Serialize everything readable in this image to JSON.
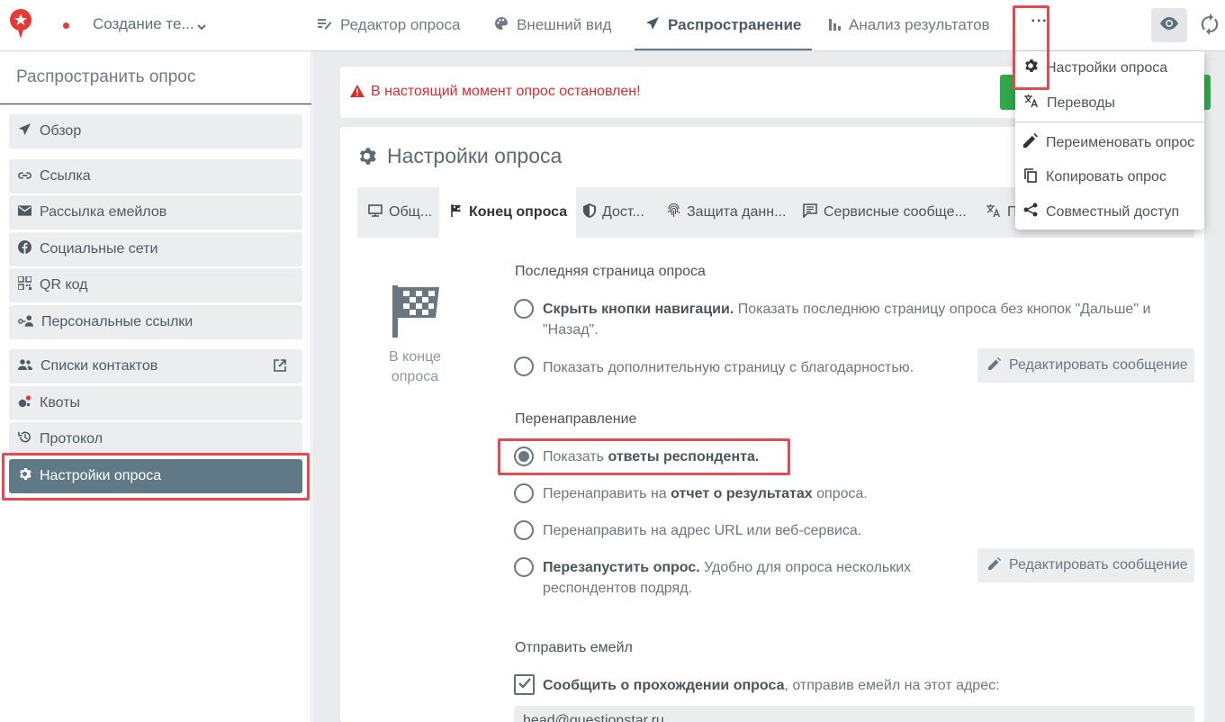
{
  "header": {
    "survey_name": "Создание те...",
    "tabs": [
      {
        "label": "Редактор опроса",
        "icon": "edit-lines-icon"
      },
      {
        "label": "Внешний вид",
        "icon": "palette-icon"
      },
      {
        "label": "Распространение",
        "icon": "send-icon",
        "active": true
      },
      {
        "label": "Анализ результатов",
        "icon": "bar-chart-icon"
      }
    ],
    "more_label": "···"
  },
  "sidebar": {
    "title": "Распространить опрос",
    "items": [
      {
        "label": "Обзор",
        "icon": "send-icon"
      },
      {
        "label": "Ссылка",
        "icon": "link-icon"
      },
      {
        "label": "Рассылка емейлов",
        "icon": "mail-icon"
      },
      {
        "label": "Социальные сети",
        "icon": "facebook-icon"
      },
      {
        "label": "QR код",
        "icon": "qr-code-icon"
      },
      {
        "label": "Персональные ссылки",
        "icon": "person-key-icon"
      },
      {
        "label": "Списки контактов",
        "icon": "people-icon"
      },
      {
        "label": "Квоты",
        "icon": "quota-icon"
      },
      {
        "label": "Протокол",
        "icon": "history-icon"
      },
      {
        "label": "Настройки опроса",
        "icon": "gear-icon",
        "active": true
      }
    ]
  },
  "alert": {
    "text": "В настоящий момент опрос остановлен!"
  },
  "settings": {
    "title": "Настройки опроса",
    "subtabs": [
      {
        "label": "Общ...",
        "icon": "monitor-icon"
      },
      {
        "label": "Конец опроса",
        "icon": "flag-icon",
        "active": true
      },
      {
        "label": "Дост...",
        "icon": "shield-icon"
      },
      {
        "label": "Защита данн...",
        "icon": "fingerprint-icon"
      },
      {
        "label": "Сервисные сообще...",
        "icon": "message-icon"
      },
      {
        "label": "П",
        "icon": "translate-icon"
      }
    ],
    "end_caption": "В конце опроса",
    "last_page": {
      "heading": "Последняя страница опроса",
      "opt1_bold": "Скрыть кнопки навигации.",
      "opt1_text": " Показать последнюю страницу опроса без кнопок \"Дальше\" и \"Назад\".",
      "opt2_text": "Показать дополнительную страницу с благодарностью.",
      "edit_label": "Редактировать сообщение"
    },
    "redirect": {
      "heading": "Перенаправление",
      "opt1_prefix": "Показать ",
      "opt1_bold": "ответы респондента.",
      "opt2_prefix": "Перенаправить на ",
      "opt2_bold": "отчет о результатах",
      "opt2_suffix": " опроса.",
      "opt3_text": "Перенаправить на адрес URL или веб-сервиса.",
      "opt4_bold": "Перезапустить опрос.",
      "opt4_text": " Удобно для опроса нескольких респондентов подряд.",
      "edit_label": "Редактировать сообщение"
    },
    "email": {
      "heading": "Отправить емейл",
      "check_bold": "Сообщить о прохождении опроса",
      "check_text": ", отправив емейл на этот адрес:",
      "address": "head@questionstar.ru",
      "checked": true
    }
  },
  "dropdown": {
    "items": [
      {
        "label": "Настройки опроса",
        "icon": "gear-icon"
      },
      {
        "label": "Переводы",
        "icon": "translate-icon"
      },
      {
        "label": "Переименовать опрос",
        "icon": "pencil-icon"
      },
      {
        "label": "Копировать опрос",
        "icon": "copy-icon"
      },
      {
        "label": "Совместный доступ",
        "icon": "share-icon"
      }
    ]
  },
  "colors": {
    "accent": "#5f7a86",
    "alert": "#d32f2f",
    "highlight": "#e24b52",
    "success": "#2eaa4b",
    "logo": "#e53935"
  }
}
